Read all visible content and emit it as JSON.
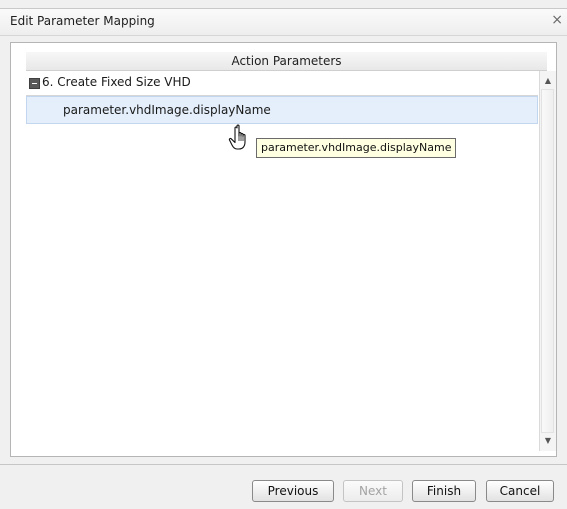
{
  "dialog": {
    "title": "Edit Parameter Mapping",
    "close_glyph": "×"
  },
  "grid": {
    "header": "Action Parameters",
    "group_label": "6. Create Fixed Size VHD",
    "rows": [
      {
        "label": "parameter.vhdImage.displayName"
      }
    ]
  },
  "scrollbar": {
    "up_glyph": "▲",
    "down_glyph": "▼"
  },
  "tooltip": {
    "text": "parameter.vhdImage.displayName"
  },
  "buttons": {
    "previous": "Previous",
    "next": "Next",
    "finish": "Finish",
    "cancel": "Cancel"
  },
  "icons": {
    "collapse": "collapse-minus-icon",
    "cursor": "hand-pointer-icon"
  }
}
